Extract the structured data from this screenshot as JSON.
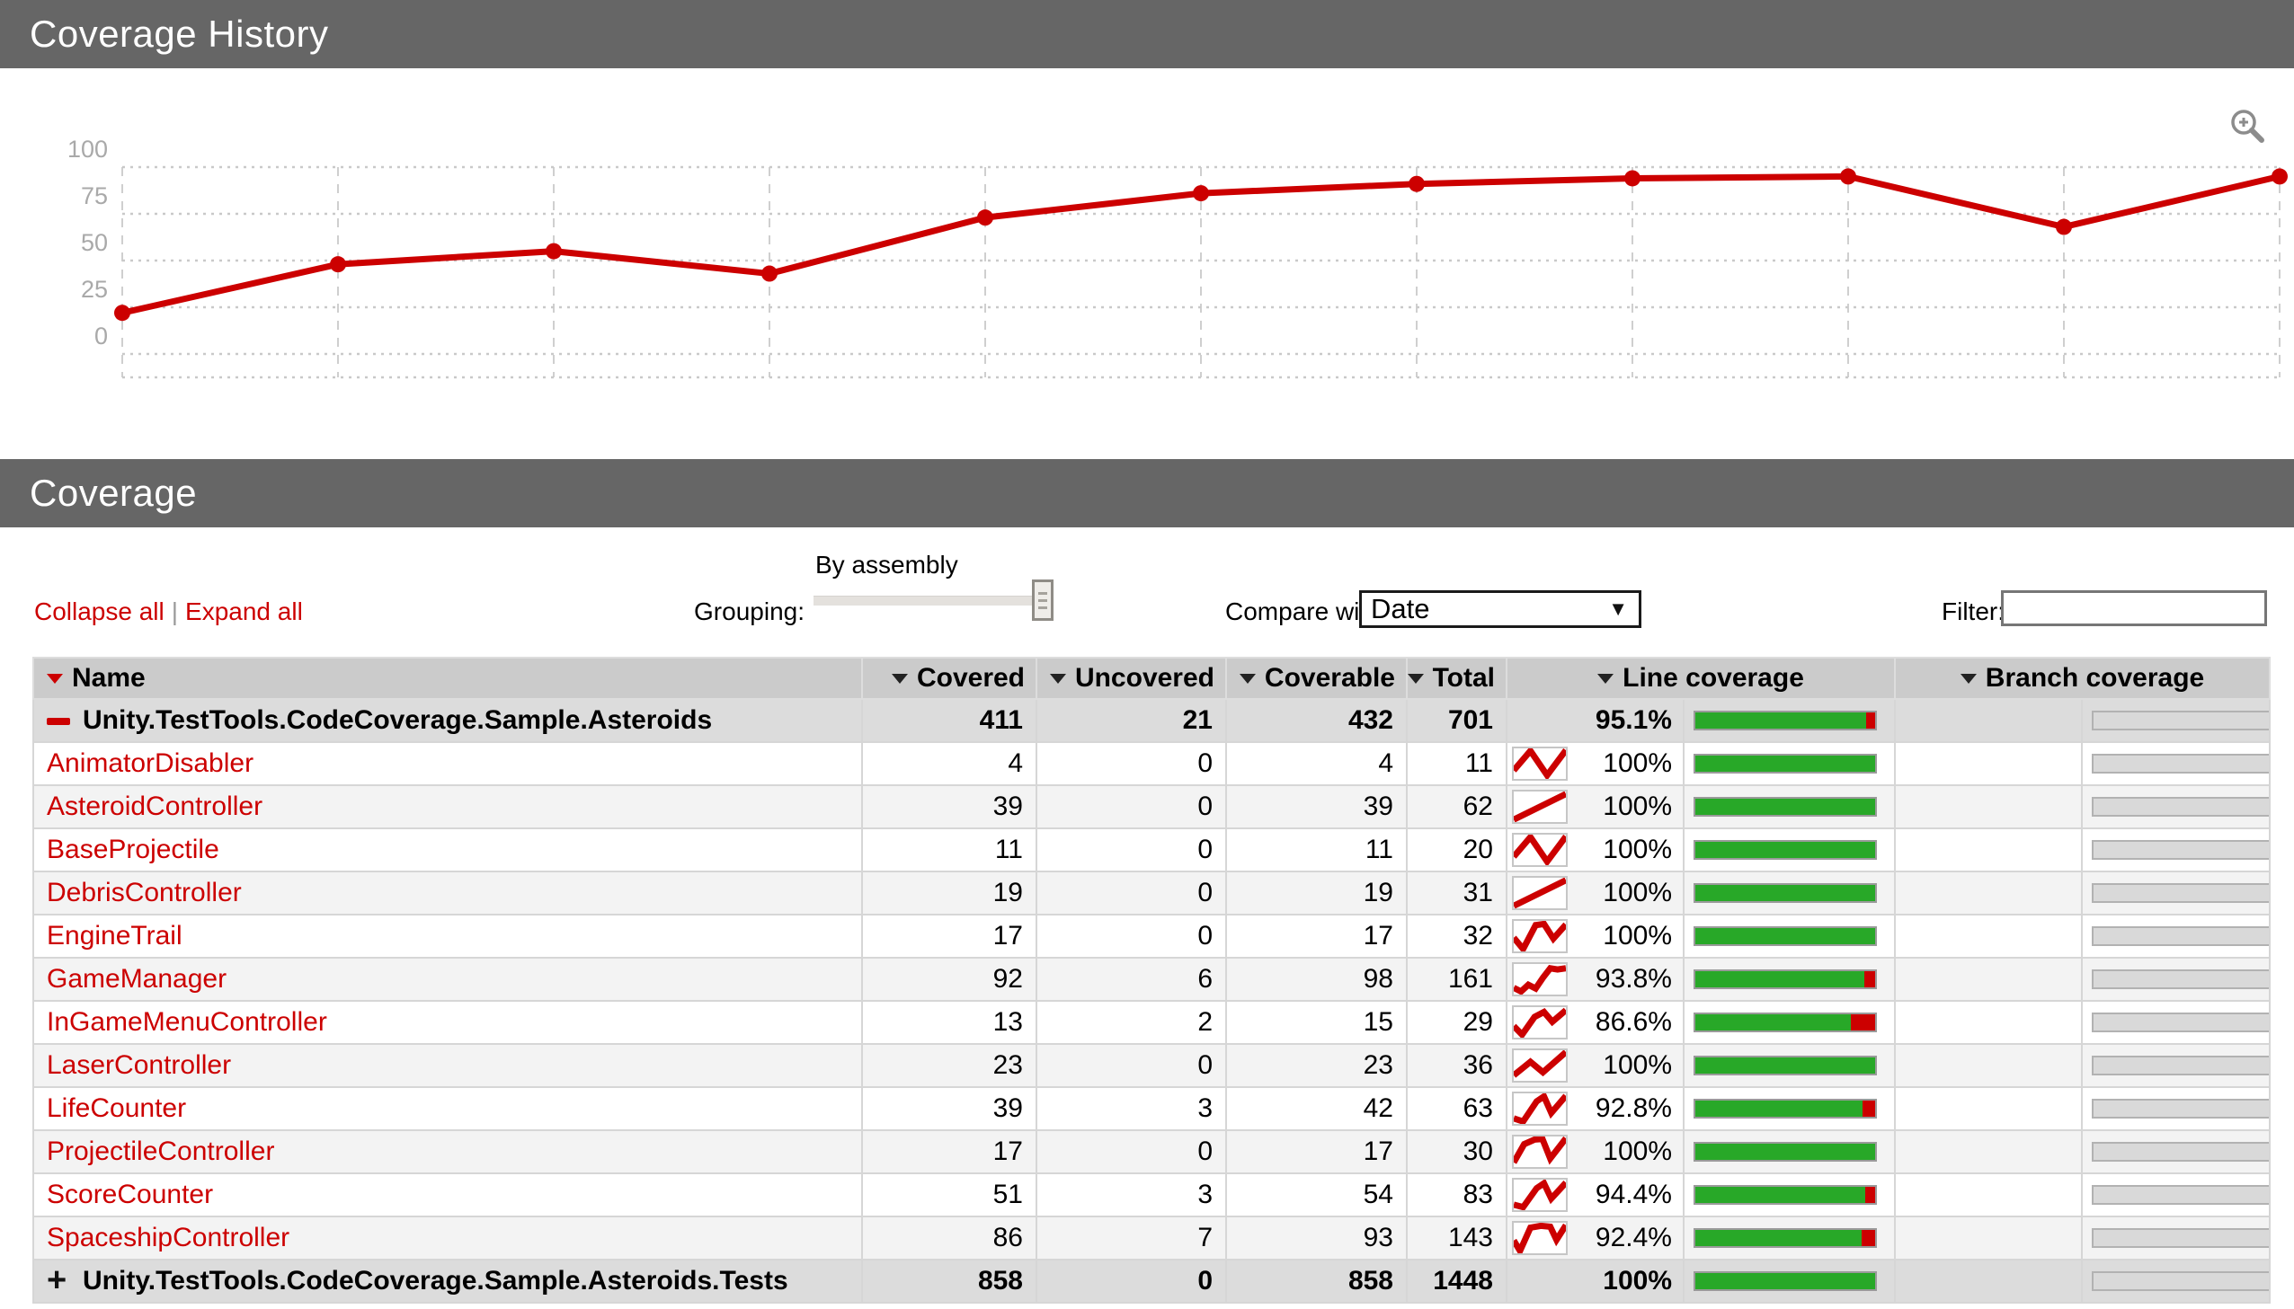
{
  "colors": {
    "accent_red": "#cc0000",
    "green": "#28a828",
    "titlebar_gray": "#666666",
    "grid": "#cccccc",
    "axis_label": "#aaaaaa"
  },
  "history": {
    "title": "Coverage History",
    "zoom_icon": "magnifier-plus"
  },
  "chart_data": {
    "type": "line",
    "series": [
      {
        "name": "Line coverage",
        "color": "#cc0000",
        "values": [
          22,
          48,
          55,
          43,
          73,
          86,
          91,
          94,
          95,
          68,
          95
        ]
      }
    ],
    "x": [
      1,
      2,
      3,
      4,
      5,
      6,
      7,
      8,
      9,
      10,
      11
    ],
    "title": "Coverage History",
    "xlabel": "",
    "ylabel": "",
    "ylim": [
      0,
      100
    ],
    "yticks": [
      0,
      25,
      50,
      75,
      100
    ],
    "grid": "dashed",
    "legend": "none",
    "markers": true
  },
  "coverage": {
    "title": "Coverage"
  },
  "controls": {
    "collapse_label": "Collapse all",
    "separator": "|",
    "expand_label": "Expand all",
    "grouping_label": "Grouping:",
    "grouping_value": "By assembly",
    "compare_label": "Compare with:",
    "compare_value": "Date",
    "filter_label": "Filter:",
    "filter_value": "",
    "filter_placeholder": ""
  },
  "table": {
    "headers": {
      "name": "Name",
      "covered": "Covered",
      "uncovered": "Uncovered",
      "coverable": "Coverable",
      "total": "Total",
      "line": "Line coverage",
      "branch": "Branch coverage"
    },
    "rows": [
      {
        "kind": "assembly",
        "icon": "minus",
        "name": "Unity.TestTools.CodeCoverage.Sample.Asteroids",
        "covered": "411",
        "uncovered": "21",
        "coverable": "432",
        "total": "701",
        "pct_label": "95.1%",
        "pct": 95.1,
        "spark": null
      },
      {
        "kind": "cls",
        "icon": null,
        "name": "AnimatorDisabler",
        "covered": "4",
        "uncovered": "0",
        "coverable": "4",
        "total": "11",
        "pct_label": "100%",
        "pct": 100,
        "spark": "0,72 32,8 64,88 100,6"
      },
      {
        "kind": "cls",
        "icon": null,
        "name": "AsteroidController",
        "covered": "39",
        "uncovered": "0",
        "coverable": "39",
        "total": "62",
        "pct_label": "100%",
        "pct": 100,
        "spark": "0,92 100,8"
      },
      {
        "kind": "cls",
        "icon": null,
        "name": "BaseProjectile",
        "covered": "11",
        "uncovered": "0",
        "coverable": "11",
        "total": "20",
        "pct_label": "100%",
        "pct": 100,
        "spark": "0,72 32,8 64,88 100,6"
      },
      {
        "kind": "cls",
        "icon": null,
        "name": "DebrisController",
        "covered": "19",
        "uncovered": "0",
        "coverable": "19",
        "total": "31",
        "pct_label": "100%",
        "pct": 100,
        "spark": "0,92 100,8"
      },
      {
        "kind": "cls",
        "icon": null,
        "name": "EngineTrail",
        "covered": "17",
        "uncovered": "0",
        "coverable": "17",
        "total": "32",
        "pct_label": "100%",
        "pct": 100,
        "spark": "0,55 18,92 42,14 58,10 76,58 100,12"
      },
      {
        "kind": "cls",
        "icon": null,
        "name": "GameManager",
        "covered": "92",
        "uncovered": "6",
        "coverable": "98",
        "total": "161",
        "pct_label": "93.8%",
        "pct": 93.8,
        "spark": "0,78 14,90 28,68 42,80 56,45 70,14 84,18 100,14"
      },
      {
        "kind": "cls",
        "icon": null,
        "name": "InGameMenuController",
        "covered": "13",
        "uncovered": "2",
        "coverable": "15",
        "total": "29",
        "pct_label": "86.6%",
        "pct": 86.6,
        "spark": "0,62 16,90 40,32 58,16 74,48 100,10"
      },
      {
        "kind": "cls",
        "icon": null,
        "name": "LaserController",
        "covered": "23",
        "uncovered": "0",
        "coverable": "23",
        "total": "36",
        "pct_label": "100%",
        "pct": 100,
        "spark": "0,82 32,38 56,72 100,6"
      },
      {
        "kind": "cls",
        "icon": null,
        "name": "LifeCounter",
        "covered": "39",
        "uncovered": "3",
        "coverable": "42",
        "total": "63",
        "pct_label": "92.8%",
        "pct": 92.8,
        "spark": "0,82 18,92 44,26 58,10 72,64 100,8"
      },
      {
        "kind": "cls",
        "icon": null,
        "name": "ProjectileController",
        "covered": "17",
        "uncovered": "0",
        "coverable": "17",
        "total": "30",
        "pct_label": "100%",
        "pct": 100,
        "spark": "0,85 20,25 40,10 55,8 70,72 100,6"
      },
      {
        "kind": "cls",
        "icon": null,
        "name": "ScoreCounter",
        "covered": "51",
        "uncovered": "3",
        "coverable": "54",
        "total": "83",
        "pct_label": "94.4%",
        "pct": 94.4,
        "spark": "0,82 18,90 44,28 58,12 72,62 100,10"
      },
      {
        "kind": "cls",
        "icon": null,
        "name": "SpaceshipController",
        "covered": "86",
        "uncovered": "7",
        "coverable": "93",
        "total": "143",
        "pct_label": "92.4%",
        "pct": 92.4,
        "spark": "0,58 12,92 32,16 52,10 70,13 82,56 100,8"
      },
      {
        "kind": "assembly",
        "icon": "plus",
        "name": "Unity.TestTools.CodeCoverage.Sample.Asteroids.Tests",
        "covered": "858",
        "uncovered": "0",
        "coverable": "858",
        "total": "1448",
        "pct_label": "100%",
        "pct": 100,
        "spark": null
      }
    ]
  }
}
